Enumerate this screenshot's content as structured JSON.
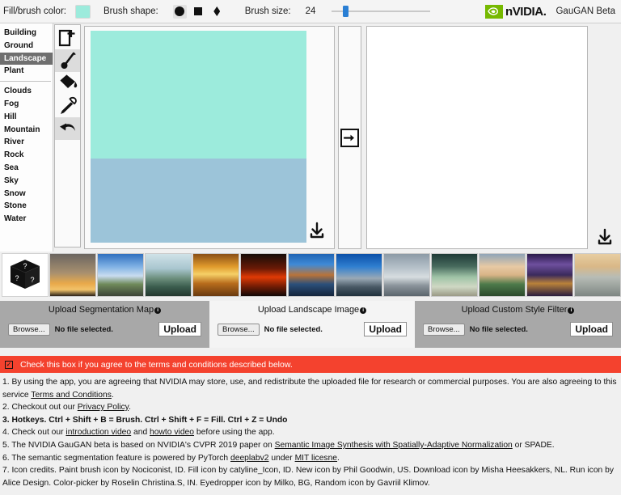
{
  "toolbar": {
    "fill_label": "Fill/brush color:",
    "fill_color": "#9cebdc",
    "shape_label": "Brush shape:",
    "shapes": [
      "circle",
      "square",
      "diamond"
    ],
    "selected_shape": "circle",
    "size_label": "Brush size:",
    "size_value": "24",
    "brand_word": "nVIDIA.",
    "product": "GauGAN Beta"
  },
  "sidebar": {
    "group1": [
      {
        "label": "Building",
        "active": false
      },
      {
        "label": "Ground",
        "active": false
      },
      {
        "label": "Landscape",
        "active": true
      },
      {
        "label": "Plant",
        "active": false
      }
    ],
    "group2": [
      {
        "label": "Clouds"
      },
      {
        "label": "Fog"
      },
      {
        "label": "Hill"
      },
      {
        "label": "Mountain"
      },
      {
        "label": "River"
      },
      {
        "label": "Rock"
      },
      {
        "label": "Sea"
      },
      {
        "label": "Sky"
      },
      {
        "label": "Snow"
      },
      {
        "label": "Stone"
      },
      {
        "label": "Water"
      }
    ]
  },
  "tools": [
    {
      "name": "new-image",
      "selected": false
    },
    {
      "name": "paint-brush",
      "selected": true
    },
    {
      "name": "fill-bucket",
      "selected": false
    },
    {
      "name": "eyedropper",
      "selected": false
    },
    {
      "name": "undo",
      "selected": true
    }
  ],
  "canvas": {
    "sky_color": "#9cebdc",
    "sea_color": "#9cc4d9",
    "sky_label": "Sky",
    "sea_label": "Sea",
    "output_bg": "#ffffff"
  },
  "run_button": {
    "name": "run-arrow"
  },
  "thumbnails": {
    "random_label": "random-style",
    "items": [
      {
        "name": "style-1",
        "g": "linear-gradient(180deg,#6b6560 0%,#a8906f 45%,#e8a94a 70%,#f2c36a 85%,#2b2219 100%)"
      },
      {
        "name": "style-2",
        "g": "linear-gradient(180deg,#2f6fbf 0%,#7fb1e4 30%,#c9dcf0 52%,#6f8a5a 72%,#3c4437 100%)"
      },
      {
        "name": "style-3",
        "g": "linear-gradient(180deg,#cfe2e8 0%,#a9c6cf 35%,#6d8f7d 58%,#3b5d4e 78%,#24382f 100%)"
      },
      {
        "name": "style-4",
        "g": "linear-gradient(180deg,#8a4f15 0%,#e09a2c 30%,#f6d067 48%,#b86c1c 70%,#6a3a10 100%)"
      },
      {
        "name": "style-5",
        "g": "linear-gradient(180deg,#160c07 0%,#6b1a06 35%,#e03a05 55%,#7d1f05 75%,#120806 100%)"
      },
      {
        "name": "style-6",
        "g": "linear-gradient(180deg,#1f64b4 0%,#3f8ad6 25%,#b8733a 50%,#2b4f7a 72%,#14243b 100%)"
      },
      {
        "name": "style-7",
        "g": "linear-gradient(180deg,#0b4fa8 0%,#2f7fd0 30%,#9aa9b5 58%,#4a5a66 78%,#20303c 100%)"
      },
      {
        "name": "style-8",
        "g": "linear-gradient(180deg,#8c9aa6 0%,#b9c4cc 35%,#d7dde0 55%,#8b949b 75%,#5b656c 100%)"
      },
      {
        "name": "style-9",
        "g": "linear-gradient(180deg,#1f3a36 0%,#486b5e 30%,#9fc3a6 55%,#cfd8c4 78%,#9a9a86 100%)"
      },
      {
        "name": "style-10",
        "g": "linear-gradient(180deg,#8fa5b8 0%,#e7c9a4 30%,#d8b487 50%,#4d7a4a 72%,#2c4a2c 100%)"
      },
      {
        "name": "style-11",
        "g": "linear-gradient(180deg,#2a1a4a 0%,#6e4f9e 25%,#3b2a5c 50%,#b9823a 70%,#2b1e3f 100%)"
      },
      {
        "name": "style-12",
        "g": "linear-gradient(180deg,#e7cda1 0%,#d9b887 30%,#b7bcb6 55%,#9aa19c 78%,#7e8682 100%)"
      }
    ]
  },
  "uploads": [
    {
      "title": "Upload Segmentation Map",
      "info": "i",
      "browse": "Browse...",
      "status": "No file selected.",
      "action": "Upload",
      "shaded": true
    },
    {
      "title": "Upload Landscape Image",
      "info": "i",
      "browse": "Browse...",
      "status": "No file selected.",
      "action": "Upload",
      "shaded": false
    },
    {
      "title": "Upload Custom Style Filter",
      "info": "i",
      "browse": "Browse...",
      "status": "No file selected.",
      "action": "Upload",
      "shaded": true
    }
  ],
  "agreement": {
    "banner_color": "#f4422e",
    "checked": true,
    "check_glyph": "✓",
    "text": "Check this box if you agree to the terms and conditions described below."
  },
  "terms": {
    "line1_a": "1. By using the app, you are agreeing that NVIDIA may store, use, and redistribute the uploaded file for research or commercial purposes. You are also agreeing to this service ",
    "line1_link": "Terms and Conditions",
    "line1_b": ".",
    "line2_a": "2. Checkout out our ",
    "line2_link": "Privacy Policy",
    "line2_b": ".",
    "line3": "3. Hotkeys. Ctrl + Shift + B = Brush. Ctrl + Shift + F = Fill. Ctrl + Z = Undo",
    "line4_a": "4. Check out our ",
    "line4_link1": "introduction video",
    "line4_b": " and ",
    "line4_link2": "howto video",
    "line4_c": " before using the app.",
    "line5_a": "5. The NVIDIA GauGAN beta is based on NVIDIA's CVPR 2019 paper on ",
    "line5_link": "Semantic Image Synthesis with Spatially-Adaptive Normalization",
    "line5_b": " or SPADE.",
    "line6_a": "6. The semantic segmentation feature is powered by PyTorch ",
    "line6_link1": "deeplabv2",
    "line6_b": " under ",
    "line6_link2": "MIT licesne",
    "line6_c": ".",
    "line7": "7. Icon credits. Paint brush icon by Nociconist, ID. Fill icon by catyline_Icon, ID. New icon by Phil Goodwin, US. Download icon by Misha Heesakkers, NL. Run icon by Alice Design. Color-picker by Roselin Christina.S, IN. Eyedropper icon by Milko, BG, Random icon by Gavriil Klimov."
  }
}
